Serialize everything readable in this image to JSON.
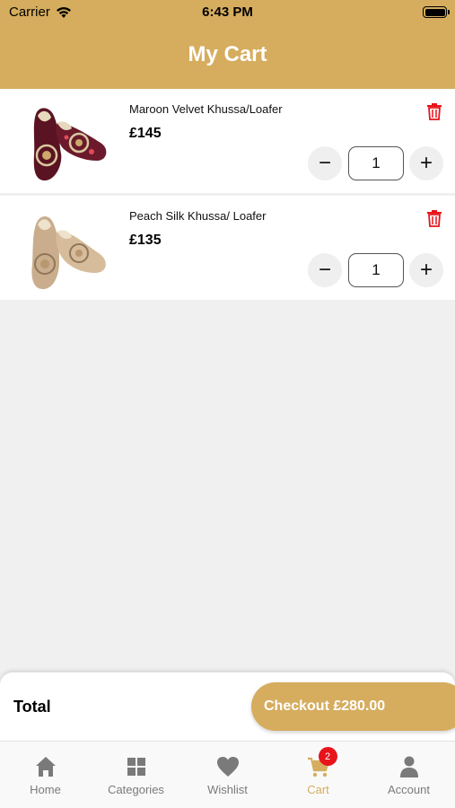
{
  "status_bar": {
    "carrier": "Carrier",
    "time": "6:43 PM"
  },
  "header": {
    "title": "My Cart"
  },
  "cart": {
    "items": [
      {
        "name": "Maroon Velvet Khussa/Loafer",
        "price": "£145",
        "quantity": "1",
        "minus": "−",
        "plus": "+"
      },
      {
        "name": "Peach Silk Khussa/ Loafer",
        "price": "£135",
        "quantity": "1",
        "minus": "−",
        "plus": "+"
      }
    ]
  },
  "summary": {
    "total_label": "Total",
    "checkout_label": "Checkout £280.00"
  },
  "tabs": [
    {
      "label": "Home",
      "icon": "home-icon"
    },
    {
      "label": "Categories",
      "icon": "grid-icon"
    },
    {
      "label": "Wishlist",
      "icon": "heart-icon"
    },
    {
      "label": "Cart",
      "icon": "cart-icon",
      "badge": "2",
      "active": true
    },
    {
      "label": "Account",
      "icon": "person-icon"
    }
  ],
  "colors": {
    "accent": "#d6ad5e",
    "delete": "#e8141b",
    "inactive": "#7a7a7a"
  }
}
